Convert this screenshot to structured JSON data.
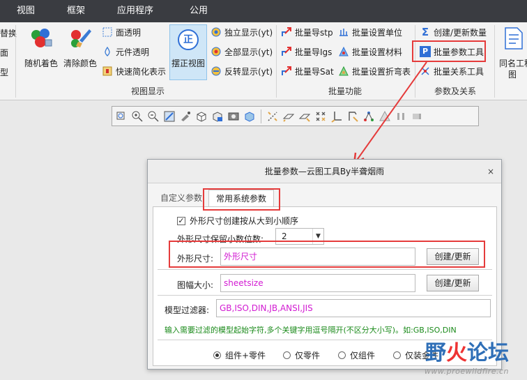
{
  "menubar": {
    "items": [
      "视图",
      "框架",
      "应用程序",
      "公用"
    ]
  },
  "ribbon": {
    "left_clipped": [
      "替换",
      "面",
      "型"
    ],
    "view_display": {
      "random_color": "随机着色",
      "clear_color": "清除颜色",
      "face_transparent": "面透明",
      "element_transparent": "元件透明",
      "quick_simplify": "快速简化表示",
      "straighten_view": "摆正视图",
      "straighten_icon_char": "正",
      "independent_display": "独立显示(yt)",
      "show_all": "全部显示(yt)",
      "reverse_display": "反转显示(yt)",
      "group_label": "视图显示"
    },
    "batch": {
      "export_stp": "批量导stp",
      "export_igs": "批量导Igs",
      "export_sat": "批量导Sat",
      "set_unit": "批量设置单位",
      "set_material": "批量设置材料",
      "set_bend": "批量设置折弯表",
      "group_label": "批量功能"
    },
    "params": {
      "create_update_count": "创建/更新数量",
      "batch_param_tool": "批量参数工具",
      "batch_relation_tool": "批量关系工具",
      "group_label": "参数及关系"
    },
    "right_clipped": {
      "same_name_line1": "同名工程",
      "same_name_line2": "图"
    }
  },
  "view_toolbar": {
    "icons": [
      "zoom-window-icon",
      "zoom-in-icon",
      "zoom-out-icon",
      "refit-icon",
      "repaint-icon",
      "cube-view-icon",
      "saved-views-icon",
      "display-style-icon",
      "perspective-icon",
      "section-icon",
      "datum-display-icon",
      "plane-display-icon",
      "axis-display-icon",
      "point-display-icon",
      "csys-display-icon",
      "annotation-icon",
      "spin-center-icon",
      "pause-icon",
      "end-icon"
    ]
  },
  "dialog": {
    "title": "批量参数—云图工具By半聋烟雨",
    "close": "×",
    "tabs": [
      "自定义参数",
      "常用系统参数"
    ],
    "active_tab": 1,
    "checkbox_order": {
      "label": "外形尺寸创建按从大到小顺序",
      "checked": true
    },
    "decimal": {
      "label": "外形尺寸保留小数位数:",
      "value": "2"
    },
    "outline_size": {
      "label": "外形尺寸:",
      "value": "外形尺寸",
      "button": "创建/更新"
    },
    "sheet_size": {
      "label": "图幅大小:",
      "value": "sheetsize",
      "button": "创建/更新"
    },
    "model_filter": {
      "label": "模型过滤器:",
      "value": "GB,ISO,DIN,JB,ANSI,JIS",
      "hint": "输入需要过滤的模型起始字符,多个关键字用逗号隔开(不区分大小写)。如:GB,ISO,DIN"
    },
    "scope": {
      "options": [
        "组件+零件",
        "仅零件",
        "仅组件",
        "仅装金件"
      ],
      "selected": 0
    }
  },
  "watermark": {
    "chars": [
      "野",
      "火",
      "论坛"
    ],
    "url": "www.proewildfire.cn"
  },
  "colors": {
    "menubar": "#3a3c41",
    "highlight_red": "#e53b3b",
    "field_text": "#d21bd2",
    "hint_green": "#1a8a1a"
  }
}
